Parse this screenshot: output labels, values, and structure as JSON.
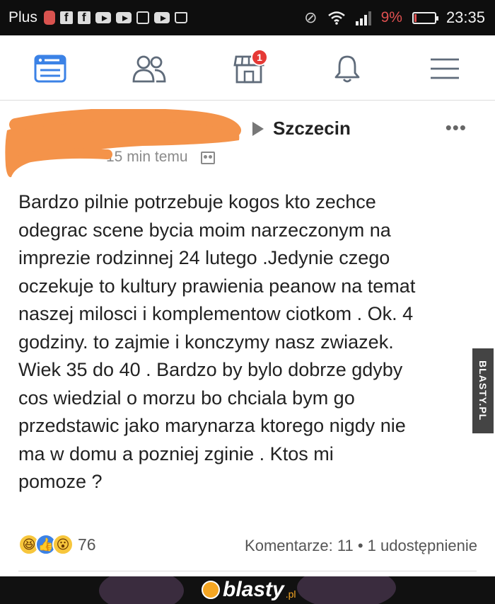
{
  "status_bar": {
    "carrier": "Plus",
    "battery_percent": "9%",
    "battery_level": 0.09,
    "time": "23:35",
    "icons": [
      "notification-icon",
      "facebook-icon",
      "facebook-icon",
      "youtube-icon",
      "youtube-icon",
      "image-icon",
      "youtube-icon",
      "bag-icon",
      "mute-icon",
      "wifi-icon",
      "signal-icon",
      "battery-icon"
    ]
  },
  "nav": {
    "items": [
      {
        "name": "news-feed-icon",
        "active": true
      },
      {
        "name": "friends-icon",
        "active": false
      },
      {
        "name": "marketplace-icon",
        "active": false,
        "badge": "1"
      },
      {
        "name": "notifications-icon",
        "active": false
      },
      {
        "name": "menu-icon",
        "active": false
      }
    ],
    "active_color": "#3b82e6",
    "inactive_color": "#5f6b7a",
    "badge": "1"
  },
  "post": {
    "page_name": "Szczecin",
    "timestamp": "15 min temu",
    "text_lines": [
      "Bardzo pilnie potrzebuje kogos kto zechce",
      "odegrac scene bycia moim narzeczonym na",
      "imprezie rodzinnej 24 lutego .Jedynie czego",
      "oczekuje to kultury prawienia peanow na temat",
      "naszej milosci i komplementow ciotkom . Ok. 4",
      "godziny. to zajmie i konczymy nasz zwiazek.",
      "Wiek 35 do 40 . Bardzo by bylo dobrze gdyby",
      "cos wiedzial o morzu bo chciala bym go",
      "przedstawic jako marynarza ktorego nigdy nie",
      "ma w domu a pozniej zginie . Ktos mi",
      "pomoze ?"
    ],
    "reaction_count": "76",
    "reactions": [
      "haha-reaction-icon",
      "like-reaction-icon",
      "wow-reaction-icon"
    ],
    "comments_shares": "Komentarze: 11 • 1 udostępnienie"
  },
  "watermark": "BLASTY.PL",
  "banner": {
    "logo_text": "blasty",
    "logo_tld": ".pl"
  }
}
